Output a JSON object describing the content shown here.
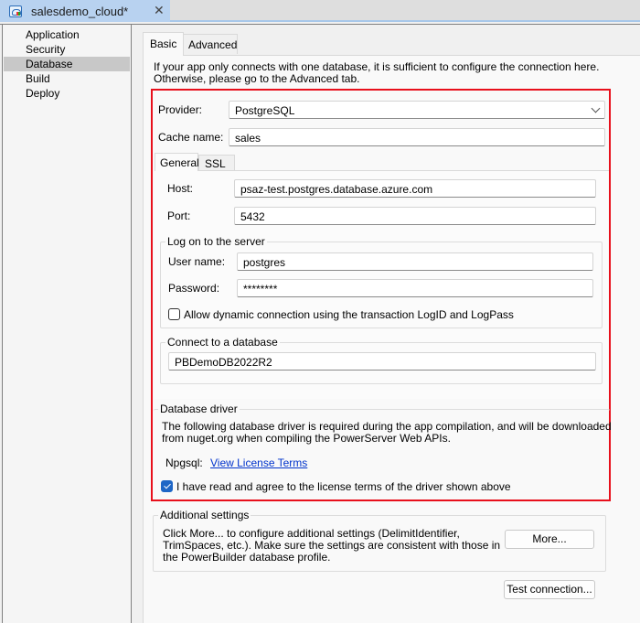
{
  "document_tab": {
    "icon": "cloud-project-icon",
    "title": "salesdemo_cloud*",
    "close_glyph": "✕"
  },
  "sidebar": {
    "items": [
      {
        "label": "Application",
        "selected": false
      },
      {
        "label": "Security",
        "selected": false
      },
      {
        "label": "Database",
        "selected": true
      },
      {
        "label": "Build",
        "selected": false
      },
      {
        "label": "Deploy",
        "selected": false
      }
    ]
  },
  "tabs": {
    "basic": "Basic",
    "advanced": "Advanced",
    "active": "Basic"
  },
  "intro": {
    "line1": "If your app only connects with one database, it is sufficient to configure the connection here.",
    "line2": "Otherwise, please go to the Advanced tab."
  },
  "provider": {
    "label": "Provider:",
    "value": "PostgreSQL"
  },
  "cache_name": {
    "label": "Cache name:",
    "value": "sales"
  },
  "subtabs": {
    "general": "General",
    "ssl": "SSL",
    "active": "General"
  },
  "host": {
    "label": "Host:",
    "value": "psaz-test.postgres.database.azure.com"
  },
  "port": {
    "label": "Port:",
    "value": "5432"
  },
  "logon": {
    "title": "Log on to the server",
    "username_label": "User name:",
    "username_value": "postgres",
    "password_label": "Password:",
    "password_value": "********",
    "dynamic_label": "Allow dynamic connection using the transaction LogID and LogPass",
    "dynamic_checked": false
  },
  "connect_db": {
    "title": "Connect to a database",
    "value": "PBDemoDB2022R2"
  },
  "driver": {
    "title": "Database driver",
    "desc_line1": "The following database driver is required during the app compilation, and will be downloaded",
    "desc_line2": "from nuget.org when compiling the PowerServer Web APIs.",
    "name": "Npgsql:",
    "license_link": "View License Terms",
    "agree_label": "I have read and agree to the license terms of the driver shown above",
    "agree_checked": true
  },
  "additional": {
    "title": "Additional settings",
    "line1": "Click More... to configure additional settings (DelimitIdentifier,",
    "line2": "TrimSpaces, etc.). Make sure the settings are consistent with those in",
    "line3": "the PowerBuilder database profile.",
    "more_button": "More..."
  },
  "test_connection_button": "Test connection...",
  "colors": {
    "highlight_border": "#e8101c",
    "checkbox_checked": "#1e66c6",
    "link": "#0033cc",
    "tab_active": "#b8d2f0"
  }
}
